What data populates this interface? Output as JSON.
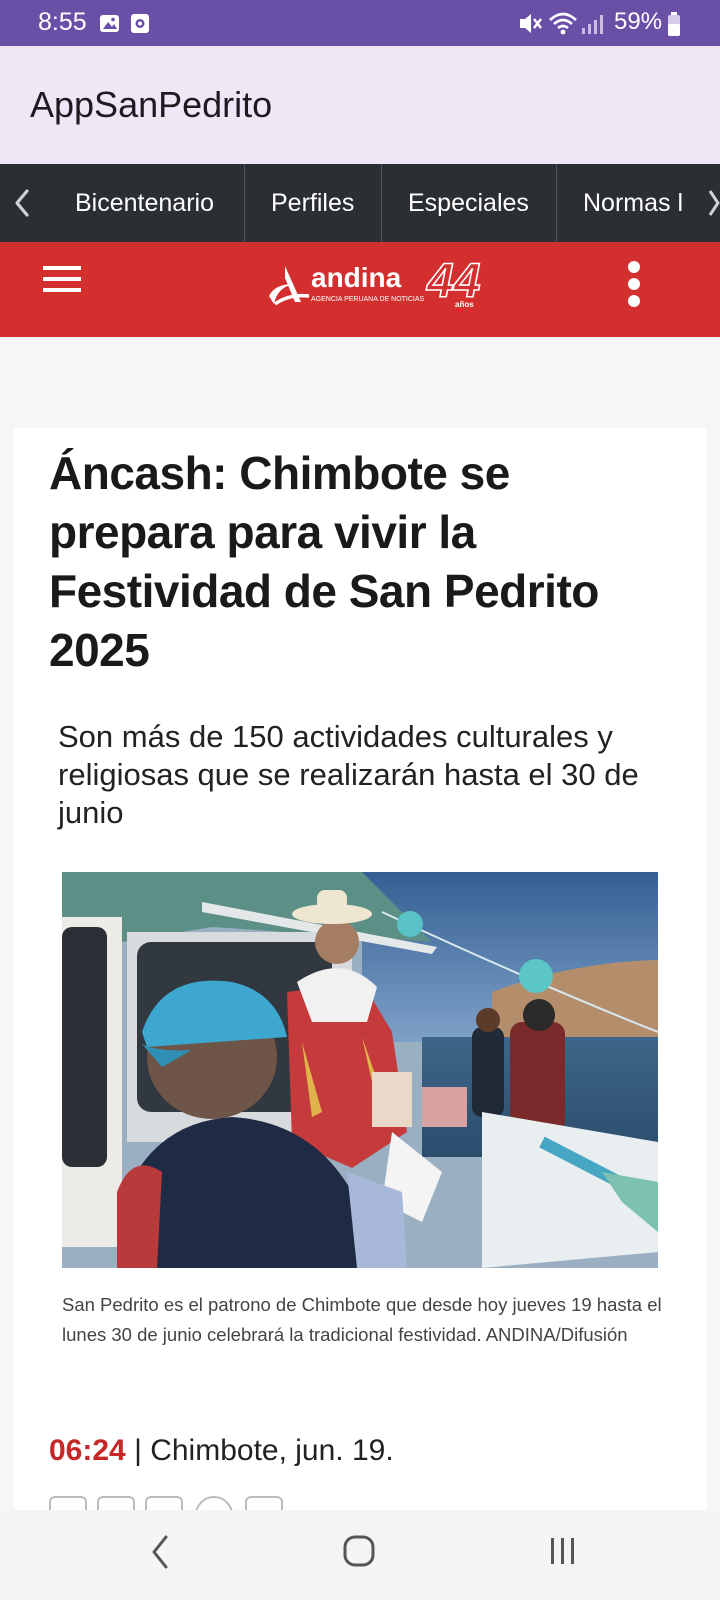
{
  "status_bar": {
    "time": "8:55",
    "battery": "59%",
    "left_icons": [
      "image-notification-icon",
      "screen-record-icon"
    ],
    "right_icons": [
      "mute-icon",
      "wifi-icon",
      "signal-icon",
      "battery-icon"
    ]
  },
  "app_bar": {
    "title": "AppSanPedrito"
  },
  "category_nav": {
    "items": [
      "Bicentenario",
      "Perfiles",
      "Especiales",
      "Normas l"
    ]
  },
  "site_header": {
    "logo_text": "andina",
    "logo_tagline": "AGENCIA PERUANA DE NOTICIAS",
    "logo_badge_number": "44",
    "logo_badge_word": "años",
    "colors": {
      "header": "#d42f2f",
      "nav": "#2b2e32",
      "status": "#6a4fa6",
      "app_bar": "#efe7f6"
    }
  },
  "article": {
    "title": "Áncash: Chimbote se prepara para vivir la Festividad de San Pedrito 2025",
    "subtitle": "Son más de 150 actividades culturales y religiosas que se realizarán hasta el 30 de junio",
    "caption": "San Pedrito es el patrono de Chimbote que desde hoy jueves 19 hasta el lunes 30 de junio celebrará la tradicional festividad. ANDINA/Difusión",
    "time": "06:24",
    "dateline": " | Chimbote, jun. 19.",
    "accent_color": "#c62828"
  },
  "share_icons": [
    "facebook-icon",
    "twitter-icon",
    "linkedin-icon",
    "whatsapp-icon",
    "email-icon"
  ],
  "nav_bar": {
    "buttons": [
      "back-icon",
      "home-icon",
      "recents-icon"
    ]
  }
}
